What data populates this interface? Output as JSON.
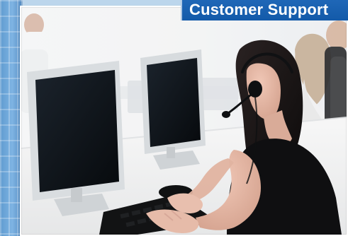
{
  "banner": {
    "title": "Customer Support"
  },
  "scene": {
    "colors": {
      "banner_blue": "#1663b6",
      "building_blue": "#6aa6da",
      "frame_white": "#ffffff",
      "monitor_dark": "#0b0f14",
      "monitor_frame": "#d7dbde",
      "skin": "#e2b6a2",
      "hair": "#1a1515",
      "top_black": "#0d0d0f"
    },
    "icons": {
      "headset": "headset-icon"
    }
  }
}
